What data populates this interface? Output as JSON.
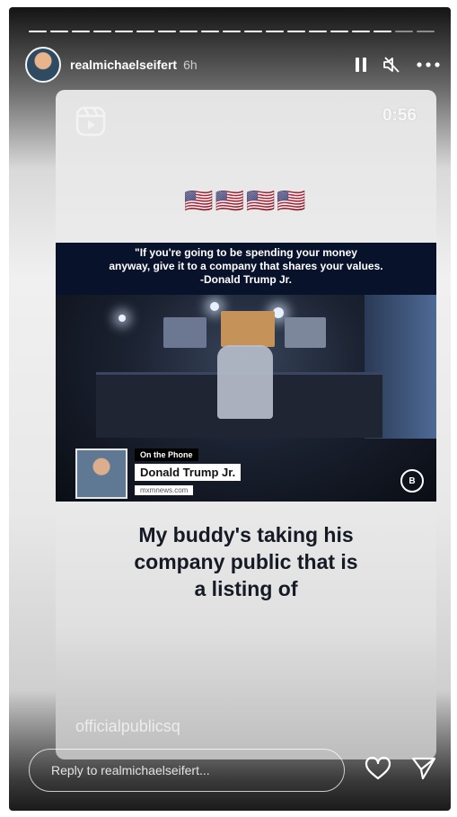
{
  "story": {
    "segments_total": 19,
    "segments_done": 17
  },
  "header": {
    "username": "realmichaelseifert",
    "time": "6h"
  },
  "card": {
    "duration": "0:56",
    "flags": "🇺🇸🇺🇸🇺🇸🇺🇸",
    "quote_line1": "\"If you're going to be spending your money",
    "quote_line2": "anyway, give it to a company that shares your values.",
    "quote_line3": "-Donald Trump Jr.",
    "lower_third": {
      "label": "On the Phone",
      "name": "Donald Trump Jr.",
      "site": "mxmnews.com"
    },
    "logo_badge": "B",
    "subtitle_line1": "My buddy's taking his",
    "subtitle_line2": "company public that is",
    "subtitle_line3": "a listing of",
    "watermark": "officialpublicsq"
  },
  "footer": {
    "reply_placeholder": "Reply to realmichaelseifert..."
  }
}
